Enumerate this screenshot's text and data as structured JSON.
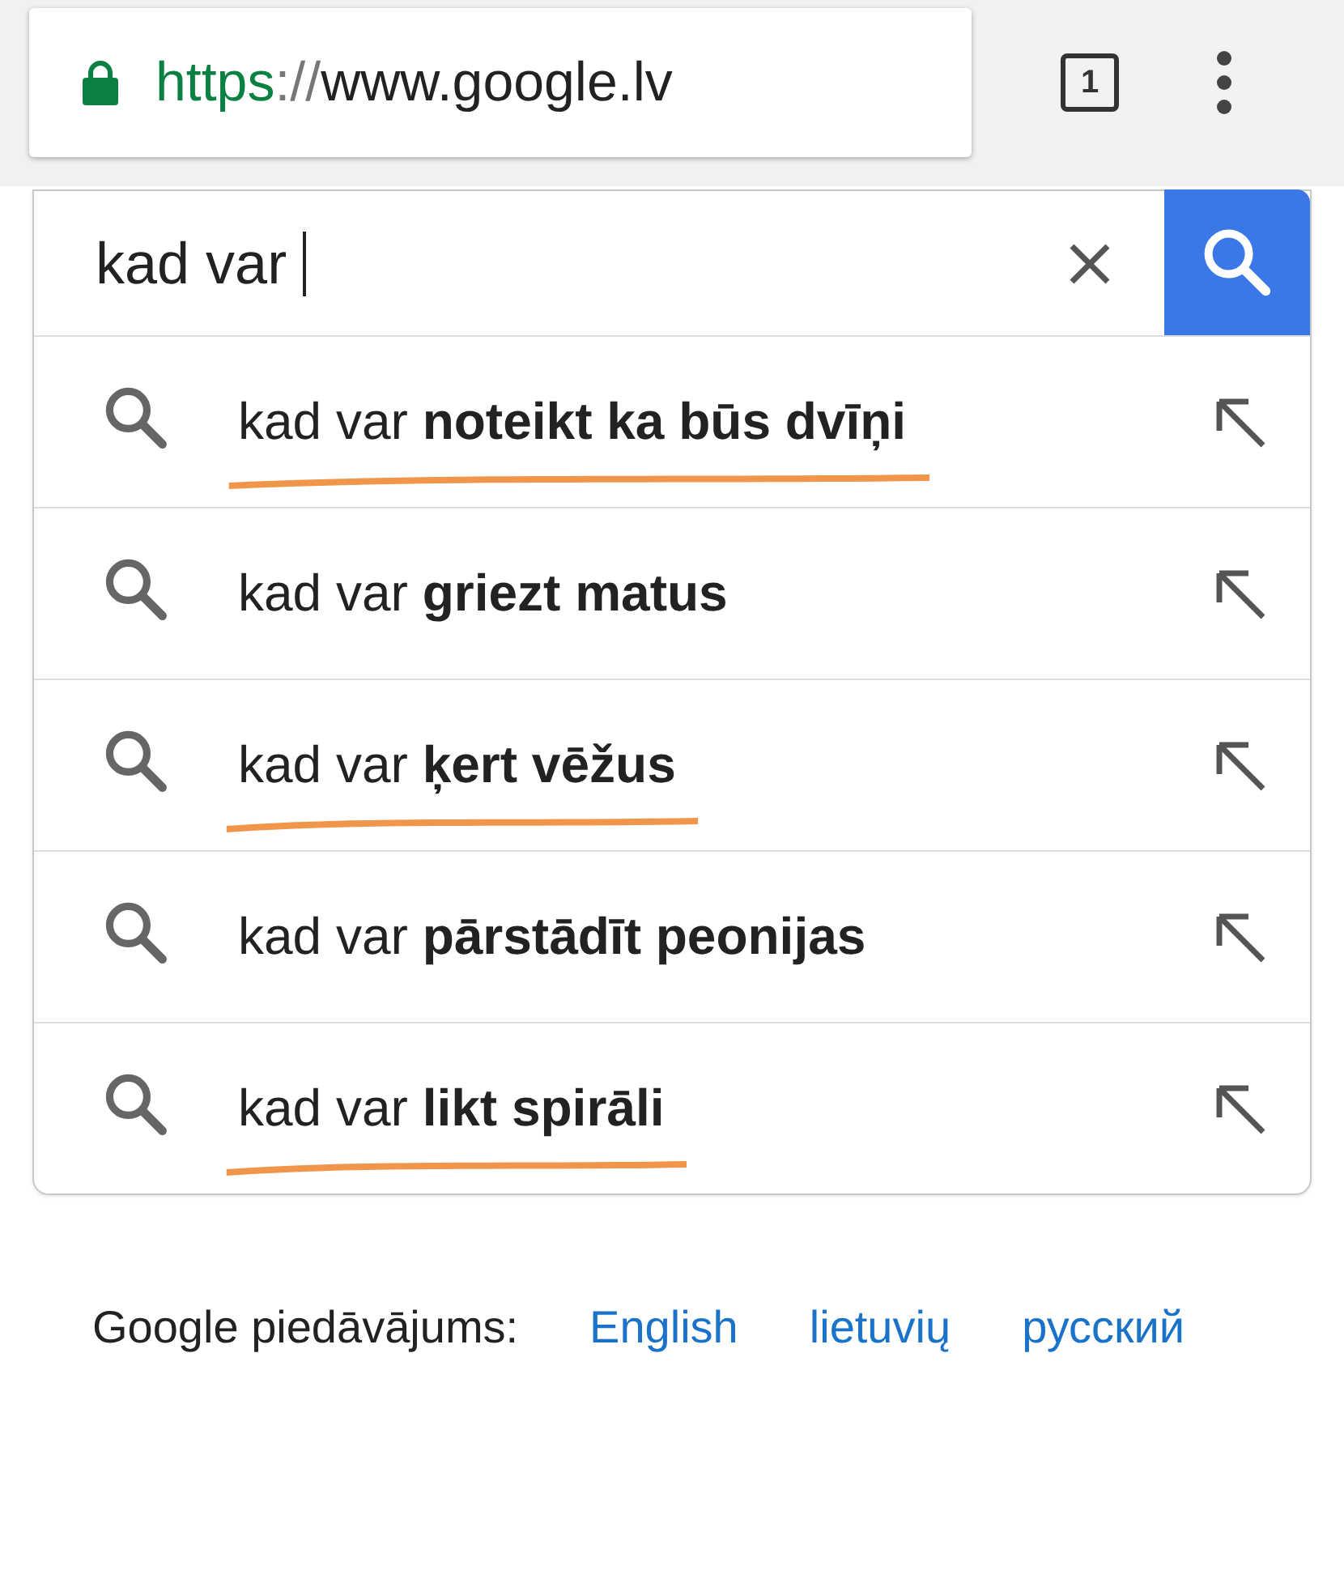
{
  "address_bar": {
    "scheme": "https",
    "separator": "://",
    "host": "www.google.lv",
    "secure": true
  },
  "tab_count": "1",
  "search": {
    "value": "kad var"
  },
  "suggestions": [
    {
      "text": "kad var **noteikt ka būs dvīņi**",
      "marked": true
    },
    {
      "text": "kad var **griezt matus**",
      "marked": false
    },
    {
      "text": "kad var **ķert vēžus**",
      "marked": true
    },
    {
      "text": "kad var **pārstādīt peonijas**",
      "marked": false
    },
    {
      "text": "kad var **likt spirāli**",
      "marked": true
    }
  ],
  "footer": {
    "label": "Google piedāvājums:",
    "languages": [
      "English",
      "lietuvių",
      "русский"
    ]
  }
}
